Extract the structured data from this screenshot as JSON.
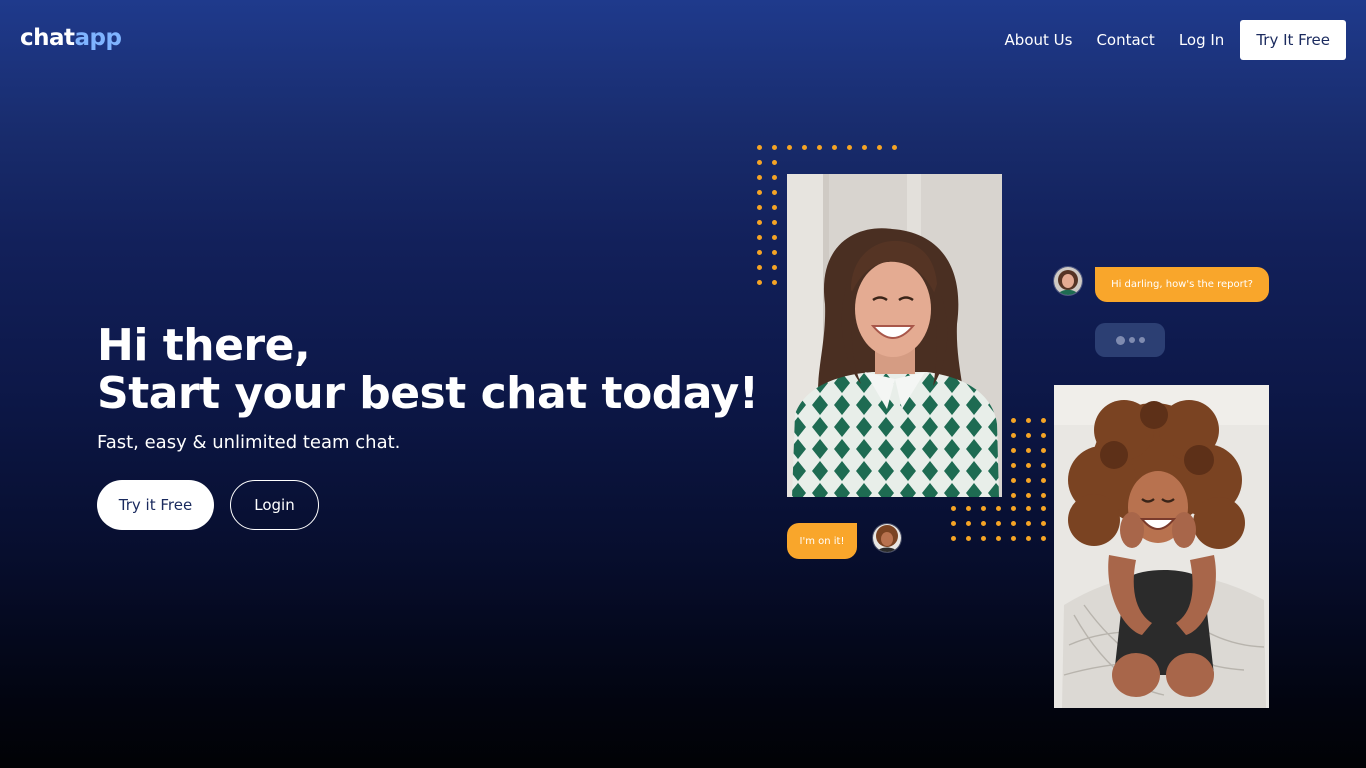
{
  "header": {
    "logo": {
      "part1": "chat",
      "part2": "app"
    },
    "nav": [
      {
        "label": "About Us"
      },
      {
        "label": "Contact"
      },
      {
        "label": "Log In"
      }
    ],
    "cta_label": "Try It Free"
  },
  "hero": {
    "title_line1": "Hi there,",
    "title_line2": "Start your best chat today!",
    "subtitle": "Fast, easy & unlimited team chat.",
    "primary_button": "Try it Free",
    "secondary_button": "Login"
  },
  "chat": {
    "message_incoming": "Hi darling, how's the report?",
    "message_outgoing": "I'm on it!"
  },
  "colors": {
    "accent_orange": "#f9a62b",
    "background_top": "#1f3a8c",
    "background_bottom": "#010205",
    "logo_accent": "#7fb4ff",
    "typing_bubble": "#2c3f73"
  },
  "icons": {
    "typing_indicator": "ellipsis-dots-icon"
  }
}
